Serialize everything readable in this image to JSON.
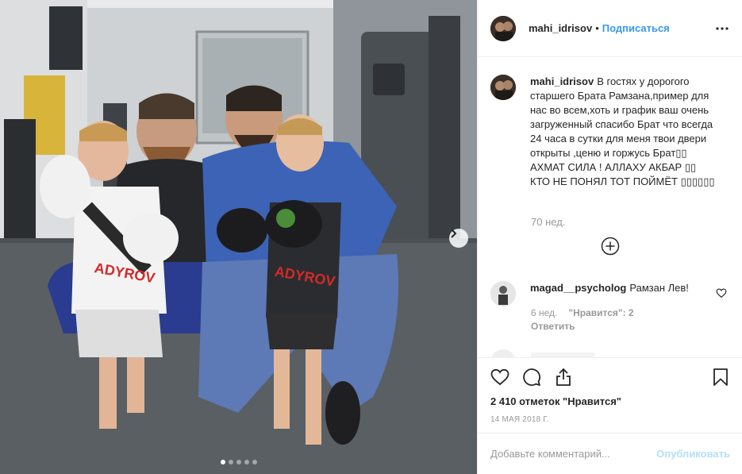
{
  "post": {
    "username": "mahi_idrisov",
    "separator": "•",
    "follow_label": "Подписаться",
    "more_icon": "ellipsis-icon"
  },
  "caption": {
    "username": "mahi_idrisov",
    "text": "В гостях у дорогого старшего Брата Рамзана,пример для нас во всем,хоть и график ваш очень загруженный спасибо Брат что всегда 24 часа в сутки для меня твои двери открыты ,ценю и горжусь Брат▯▯ АХМАТ СИЛА ! АЛЛАХУ АКБАР ▯▯ КТО НЕ ПОНЯЛ ТОТ ПОЙМЁТ ▯▯▯▯▯▯",
    "time": "70 нед."
  },
  "comment": {
    "username": "magad__psycholog",
    "text": "Рамзан Лев!",
    "time": "6 нед.",
    "likes": "\"Нравится\": 2",
    "reply_label": "Ответить"
  },
  "actions": {
    "likes_text": "2 410 отметок \"Нравится\"",
    "date": "14 МАЯ 2018 Г."
  },
  "add_comment": {
    "placeholder": "Добавьте комментарий...",
    "post_label": "Опубликовать"
  },
  "carousel": {
    "total_slides": 5,
    "current_slide": 1
  },
  "colors": {
    "link_blue": "#3897f0",
    "post_disabled": "#b2dffc",
    "muted": "#999999"
  }
}
